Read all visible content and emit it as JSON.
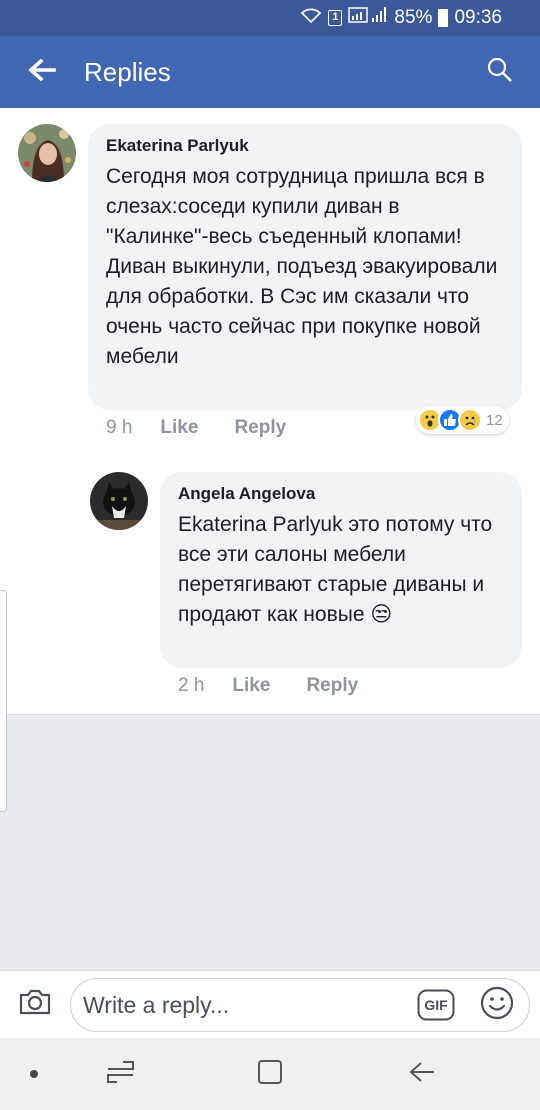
{
  "status_bar": {
    "battery": "85%",
    "time": "09:36",
    "sim": "1"
  },
  "header": {
    "title": "Replies",
    "back_icon": "arrow-left-icon",
    "search_icon": "search-icon"
  },
  "comments": [
    {
      "author": "Ekaterina Parlyuk",
      "text": "Сегодня моя сотрудница пришла вся в слезах:соседи купили диван в \"Калинке\"-весь съеденный клопами!Диван выкинули, подъезд эвакуировали для обработки. В Сэс им сказали что очень часто сейчас при покупке новой мебели",
      "time": "9 h",
      "like": "Like",
      "reply": "Reply",
      "reactions": {
        "icons": [
          "wow",
          "like",
          "sad"
        ],
        "count": "12"
      }
    },
    {
      "author": "Angela Angelova",
      "text": "Ekaterina Parlyuk это потому что все эти салоны мебели перетягивают старые диваны и продают как новые",
      "emoji": "😒",
      "time": "2 h",
      "like": "Like",
      "reply": "Reply"
    }
  ],
  "reply_bar": {
    "placeholder": "Write a reply...",
    "gif": "GIF"
  },
  "colors": {
    "header": "#4267b2",
    "status": "#3b5998",
    "bubble": "#f2f3f5",
    "meta": "#90949c"
  }
}
